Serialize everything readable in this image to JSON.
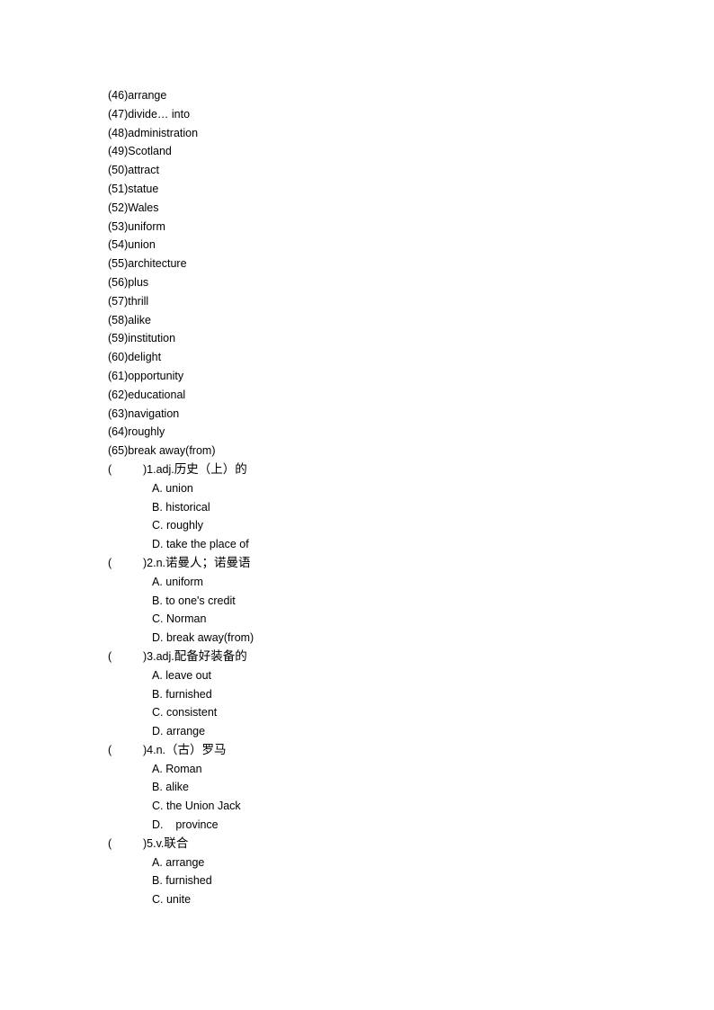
{
  "vocab_list": [
    {
      "num": "(46)",
      "word": "arrange"
    },
    {
      "num": "(47)",
      "word": "divide… into"
    },
    {
      "num": "(48)",
      "word": "administration"
    },
    {
      "num": "(49)",
      "word": "Scotland"
    },
    {
      "num": "(50)",
      "word": "attract"
    },
    {
      "num": "(51)",
      "word": "statue"
    },
    {
      "num": "(52)",
      "word": "Wales"
    },
    {
      "num": "(53)",
      "word": "uniform"
    },
    {
      "num": "(54)",
      "word": "union"
    },
    {
      "num": "(55)",
      "word": "architecture"
    },
    {
      "num": "(56)",
      "word": "plus"
    },
    {
      "num": "(57)",
      "word": "thrill"
    },
    {
      "num": "(58)",
      "word": "alike"
    },
    {
      "num": "(59)",
      "word": "institution"
    },
    {
      "num": "(60)",
      "word": "delight"
    },
    {
      "num": "(61)",
      "word": "opportunity"
    },
    {
      "num": "(62)",
      "word": "educational"
    },
    {
      "num": "(63)",
      "word": "navigation"
    },
    {
      "num": "(64)",
      "word": "roughly"
    },
    {
      "num": "(65)",
      "word": "break away(from)"
    }
  ],
  "questions": [
    {
      "paren_open": "(",
      "prefix": ")1.adj.",
      "meaning": "历史（上）的",
      "options": [
        "A. union",
        "B. historical",
        "C. roughly",
        "D. take the place of"
      ]
    },
    {
      "paren_open": "(",
      "prefix": ")2.n.",
      "meaning": "诺曼人；诺曼语",
      "options": [
        "A. uniform",
        "B. to one's credit",
        "C. Norman",
        "D. break away(from)"
      ]
    },
    {
      "paren_open": "(",
      "prefix": ")3.adj.",
      "meaning": "配备好装备的",
      "options": [
        "A. leave out",
        "B. furnished",
        "C. consistent",
        "D. arrange"
      ]
    },
    {
      "paren_open": "(",
      "prefix": ")4.n.",
      "meaning": "（古）罗马",
      "options": [
        "A. Roman",
        "B. alike",
        "C. the Union Jack",
        "D.    province"
      ]
    },
    {
      "paren_open": "(",
      "prefix": ")5.v.",
      "meaning": "联合",
      "options": [
        "A. arrange",
        "B. furnished",
        "C. unite"
      ]
    }
  ]
}
